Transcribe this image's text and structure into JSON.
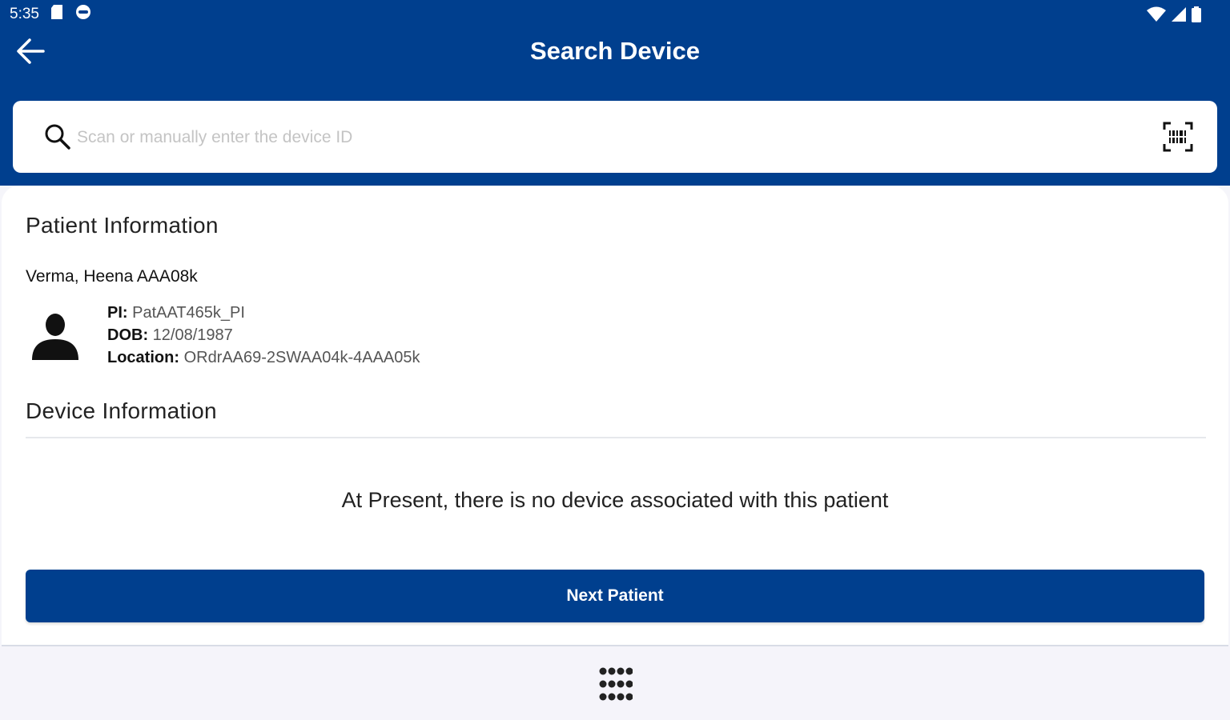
{
  "status_bar": {
    "time": "5:35",
    "left_icons": [
      "sd-card-icon",
      "sync-icon"
    ],
    "right_icons": [
      "wifi-icon",
      "signal-icon",
      "battery-icon"
    ]
  },
  "header": {
    "title": "Search Device",
    "back_icon": "arrow-left-icon",
    "background_color": "#003F8E"
  },
  "search": {
    "placeholder": "Scan or manually enter the device ID",
    "value": "",
    "search_icon": "search-icon",
    "scan_icon": "barcode-scan-icon"
  },
  "patient": {
    "section_title": "Patient Information",
    "name": "Verma, Heena AAA08k",
    "avatar_icon": "person-icon",
    "pi_label": "PI:",
    "pi_value": "PatAAT465k_PI",
    "dob_label": "DOB:",
    "dob_value": "12/08/1987",
    "location_label": "Location:",
    "location_value": "ORdrAA69-2SWAA04k-4AAA05k"
  },
  "device": {
    "section_title": "Device Information",
    "empty_message": "At Present, there is no device associated with this patient"
  },
  "actions": {
    "next_patient_label": "Next Patient"
  },
  "nav": {
    "apps_icon": "app-grid-icon"
  },
  "colors": {
    "primary": "#003F8E",
    "surface": "#FFFFFF",
    "placeholder": "#C4C4C4"
  }
}
